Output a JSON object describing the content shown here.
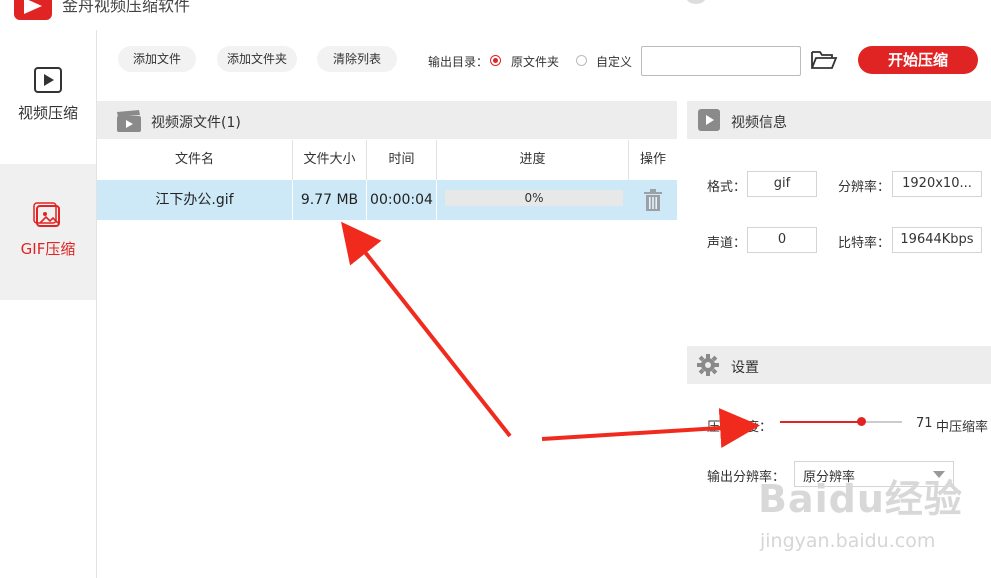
{
  "app": {
    "title": "金舟视频压缩软件"
  },
  "sidebar": {
    "items": [
      {
        "label": "视频压缩",
        "icon": "play-icon"
      },
      {
        "label": "GIF压缩",
        "icon": "image-icon"
      }
    ]
  },
  "toolbar": {
    "add_file": "添加文件",
    "add_folder": "添加文件夹",
    "clear_list": "清除列表",
    "output_dir_label": "输出目录：",
    "option_source": "原文件夹",
    "option_custom": "自定义",
    "custom_path_value": "",
    "start": "开始压缩"
  },
  "source_panel": {
    "title": "视频源文件(1)",
    "columns": [
      "文件名",
      "文件大小",
      "时间",
      "进度",
      "操作"
    ],
    "rows": [
      {
        "name": "江下办公.gif",
        "size": "9.77 MB",
        "time": "00:00:04",
        "progress": "0%"
      }
    ]
  },
  "info_panel": {
    "title": "视频信息",
    "format_label": "格式：",
    "format_value": "gif",
    "resolution_label": "分辨率：",
    "resolution_value": "1920x10...",
    "channel_label": "声道：",
    "channel_value": "0",
    "bitrate_label": "比特率：",
    "bitrate_value": "19644Kbps"
  },
  "settings_panel": {
    "title": "设置",
    "strength_label": "压缩强度：",
    "strength_value": "71",
    "strength_level": 0.71,
    "strength_text": "中压缩率",
    "out_res_label": "输出分辨率：",
    "out_res_value": "原分辨率"
  },
  "watermark": {
    "main": "Baidu经验",
    "sub": "jingyan.baidu.com"
  },
  "colors": {
    "accent": "#e02424",
    "row_selected": "#cde9f8",
    "panel_header": "#ededed"
  }
}
